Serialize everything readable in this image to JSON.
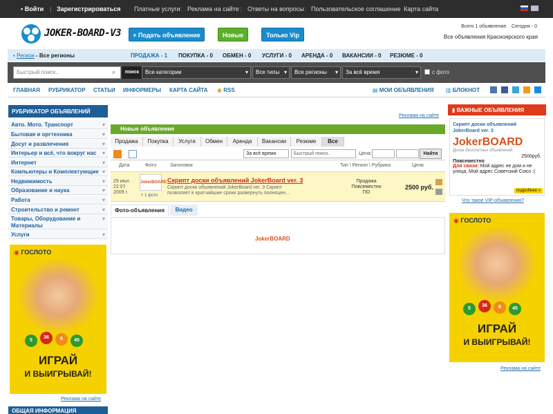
{
  "topbar": {
    "login": "Войти",
    "register": "Зарегистрироваться",
    "links": [
      "Платные услуги",
      "Реклама на сайте",
      "Ответы на вопросы",
      "Пользовательское соглашение",
      "Карта сайта"
    ],
    "sep": "::"
  },
  "header": {
    "logo_text": "JOKER-BOARD-V3",
    "add_button": "+ Подать объявление",
    "new_button": "Новые",
    "vip_button": "Только Vip",
    "total": "Всего 1 объявление",
    "today": "Сегодня - 0",
    "region_all": "Все объявления Красноярского края"
  },
  "regionbar": {
    "region_label": "Регион",
    "region_value": "- Все регионы",
    "counts": [
      "ПРОДАЖА - 1",
      "ПОКУПКА - 0",
      "ОБМЕН - 0",
      "УСЛУГИ - 0",
      "АРЕНДА - 0",
      "ВАКАНСИИ - 0",
      "РЕЗЮМЕ - 0"
    ]
  },
  "search": {
    "placeholder": "Быстрый поиск..",
    "button": "поиск",
    "category": "Все категории",
    "type": "Все типы",
    "region": "Все регионы",
    "time": "За всё время",
    "photo": "с фото"
  },
  "nav": {
    "items": [
      "ГЛАВНАЯ",
      "РУБРИКАТОР",
      "СТАТЬИ",
      "ИНФОРМЕРЫ",
      "КАРТА САЙТА",
      "RSS"
    ],
    "my_ads": "МОИ ОБЪЯВЛЕНИЯ",
    "notepad": "БЛОКНОТ"
  },
  "sidebar": {
    "title": "РУБРИКАТОР ОБЪЯВЛЕНИЙ",
    "items": [
      "Авто. Мото. Транспорт",
      "Бытовая и оргтехника",
      "Досуг и развлечения",
      "Интерьер и всё, что вокруг нас",
      "Интернет",
      "Компьютеры и Комплектующие",
      "Недвижимость",
      "Образование и наука",
      "Работа",
      "Строительство и ремонт",
      "Товары, Оборудование и Материалы",
      "Услуги"
    ],
    "ad_link": "Реклама на сайте",
    "info_title": "ОБЩАЯ ИНФОРМАЦИЯ"
  },
  "main": {
    "ad_link": "Реклама на сайте",
    "title": "Новые объявления",
    "tabs": [
      "Продажа",
      "Покупка",
      "Услуги",
      "Обмен",
      "Аренда",
      "Вакансии",
      "Резюме",
      "Все"
    ],
    "filter_time": "За всё время",
    "filter_search": "Быстрый поиск..",
    "price_label": "Цена:",
    "find_button": "Найти",
    "columns": [
      "Дата",
      "Фото",
      "Заголовок",
      "Тип \\ Регион \\ Рубрика",
      "Цена"
    ],
    "row": {
      "date1": "29 июл",
      "date2": "22:07",
      "date3": "2009 г.",
      "photo_count": "+ 1 фото",
      "title": "Скрипт доски объявлений JokerBoard ver. 3",
      "desc": "Скрипт доски объявлений JokerBoard ver. 3 Скрипт позволяет в кратчайшие сроки развернуть полноцен...",
      "type": "Продажа",
      "region": "Повсеместно",
      "rubric": "ПО",
      "price": "2500 руб."
    },
    "photo_tab": "Фото-объявления",
    "video_tab": "Видео",
    "thumb_logo": "JokerBOARD"
  },
  "right": {
    "title": "ВАЖНЫЕ ОБЪЯВЛЕНИЯ",
    "vip_title": "Скрипт доски объявлений JokerBoard ver. 3",
    "vip_logo": "JokerBOARD",
    "vip_logo_sub": "Доска бесплатных объявлений",
    "vip_price": "2500руб.",
    "vip_region": "Повсеместно",
    "vip_contact_label": "Для связи:",
    "vip_contact": "Мой адрес не дом и не улица, Мой адрес Советский Союз :(",
    "more": "подробнее »",
    "vip_question": "Что такое VIP-объявления?",
    "ad_link": "Реклама на сайте"
  },
  "banner": {
    "brand": "ГОСЛОТО",
    "balls": [
      "5",
      "36",
      "6",
      "45"
    ],
    "line1": "ИГРАЙ",
    "line2": "И ВЫИГРЫВАЙ!"
  },
  "colors": {
    "accent": "#1a8ccc",
    "green": "#6aa82c",
    "red": "#e03a1a",
    "navy": "#1e5e96"
  }
}
